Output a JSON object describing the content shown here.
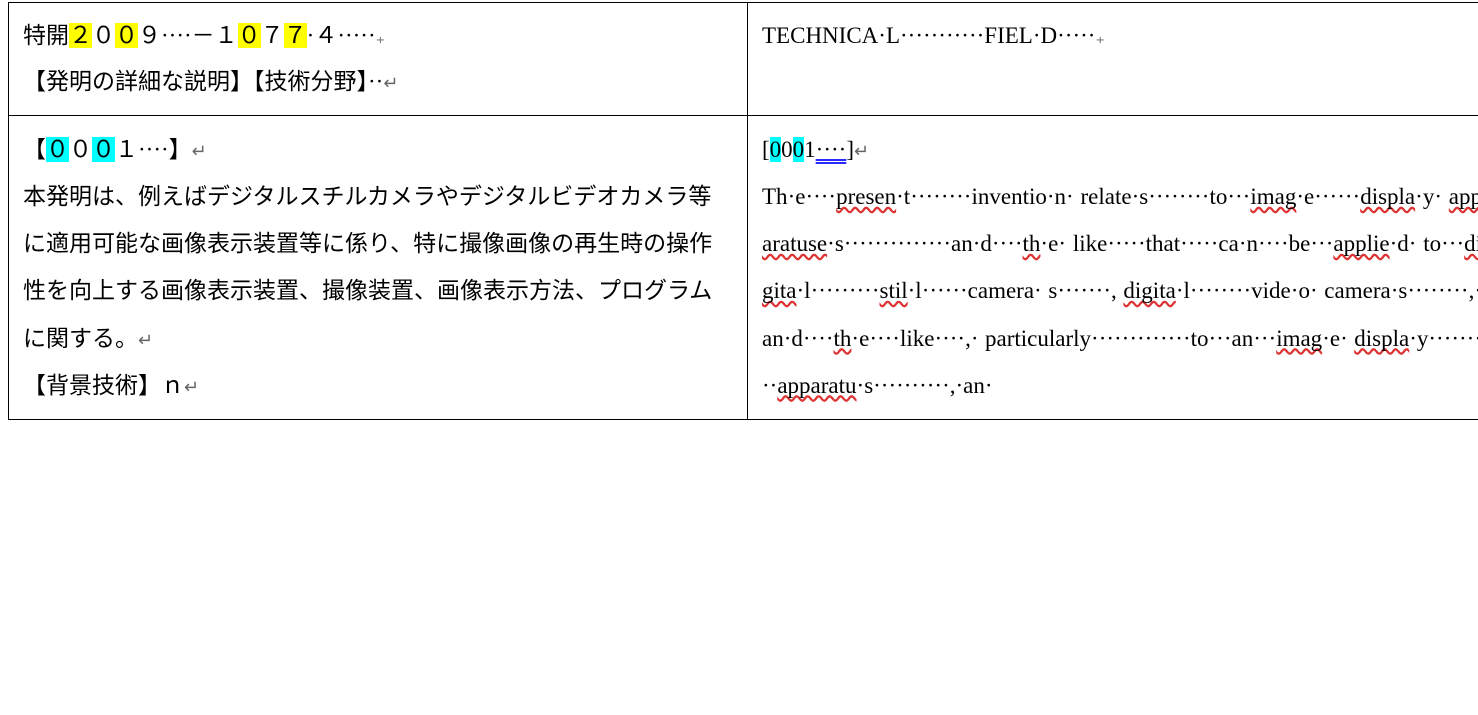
{
  "formatting": {
    "dot": "·",
    "para_mark": "↵",
    "en_para_mark": "₊"
  },
  "row1": {
    "left": {
      "prefix": "特開",
      "n1": "２",
      "n2": "０",
      "n3": "０",
      "n4": "９",
      "dots1": "····",
      "dash": "－",
      "n5": "１",
      "n6": "０",
      "n7": "７",
      "n8": "７",
      "dotA": "·",
      "n9": "４",
      "dots2": "·····",
      "pm": "₊",
      "line2": "【発明の詳細な説明】【技術分野】",
      "dots_line2": "··",
      "pm2": "↵"
    },
    "right": {
      "w1a": "TECHNICA",
      "w1b": "·",
      "w1c": "L",
      "dots1": "···········",
      "w2a": "FIEL",
      "w2b": "·",
      "w2c": "D",
      "dots2": "·····",
      "pm": "₊"
    }
  },
  "row2": {
    "left": {
      "bracket_open": "【",
      "d1": "０",
      "d2": "０",
      "d3": "０",
      "d4": "１",
      "dots_para": "····",
      "bracket_close": "】",
      "pm": "↵",
      "body": "本発明は、例えばデジタルスチルカメラやデジタルビデオカメラ等に適用可能な画像表示装置等に係り、特に撮像画像の再生時の操作性を向上する画像表示装置、撮像装置、画像表示方法、プログラムに関する。",
      "pm2": "↵",
      "bg_label": "【背景技術】ｎ",
      "pm3": "↵"
    },
    "right": {
      "lb": "[",
      "d1": "0",
      "d2": "0",
      "d3": "0",
      "d4": "1",
      "dots_para": "····",
      "rb": "]",
      "pm": "↵",
      "t": {
        "Th": "Th",
        "d1": "·",
        "e1": "e",
        "d2": "····",
        "presen": "presen",
        "d3": "·",
        "t1": "t",
        "d4": "········",
        "inventio": "inventio",
        "d5": "·",
        "n1": "n",
        "d6": "·",
        "relate": "relate",
        "d7": "·",
        "s1": "s",
        "d8": "········",
        "to1": "to",
        "d9": "···",
        "imag1": "imag",
        "d10": "·",
        "e2": "e",
        "d11": "······",
        "displa1": "displa",
        "d12": "·",
        "y1": "y",
        "d13": "·",
        "apparatuse": "apparatuse",
        "d14": "·",
        "s2": "s",
        "d15": "··············",
        "an1": "an",
        "d16": "·",
        "dC1": "d",
        "d17": "····",
        "th1": "th",
        "d18": "·",
        "e3": "e",
        "d19": "·",
        "like1": "like",
        "d20": "·····",
        "that": "that",
        "d21": "·····",
        "ca": "ca",
        "d22": "·",
        "n2": "n",
        "d23": "····",
        "be": "be",
        "d24": "···",
        "applie": "applie",
        "d25": "·",
        "dC2": "d",
        "d26": "·",
        "to2": "to",
        "d27": "···",
        "digita1": "digita",
        "d28": "·",
        "l1": "l",
        "d29": "·········",
        "stil": "stil",
        "d30": "·",
        "l2": "l",
        "d31": "······",
        "camera1": "camera",
        "d32": "·",
        "s3": "s",
        "d33": "·······",
        "com1": ",",
        "sp1": " ",
        "digita2": "digita",
        "d34": "·",
        "l3": "l",
        "d35": "········",
        "vide": "vide",
        "d36": "·",
        "o1": "o",
        "d37": "·",
        "camera2": "camera",
        "d38": "·",
        "s4": "s",
        "d39": "········",
        "com2": ",",
        "d40": "·",
        "an2": "an",
        "d41": "·",
        "dC3": "d",
        "d42": "····",
        "th2": "th",
        "d43": "·",
        "e4": "e",
        "d44": "····",
        "like2": "like",
        "d45": "····",
        "com3": ",",
        "d46": "·",
        "particularly": "particularly",
        "d47": "·············",
        "to3": "to",
        "d48": "···",
        "an3": "an",
        "d49": "···",
        "imag2": "imag",
        "d50": "·",
        "e5": "e",
        "d51": "·",
        "displa2": "displa",
        "d52": "·",
        "y2": "y",
        "d53": "·········",
        "apparatu": "apparatu",
        "d54": "·",
        "s5": "s",
        "d55": "··········",
        "com4": ",",
        "d56": "·",
        "an4": "an",
        "d57": "·"
      }
    }
  }
}
